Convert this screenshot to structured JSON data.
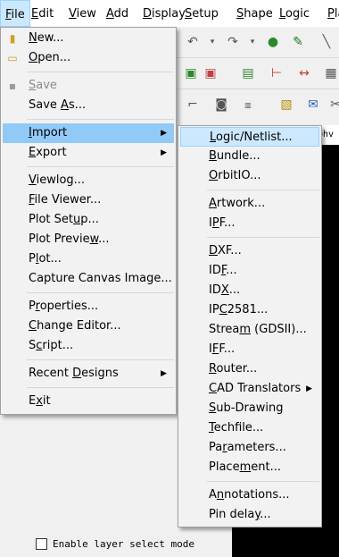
{
  "menubar": [
    {
      "pre": "",
      "ul": "F",
      "post": "ile",
      "active": true
    },
    {
      "pre": "",
      "ul": "E",
      "post": "dit"
    },
    {
      "pre": "",
      "ul": "V",
      "post": "iew"
    },
    {
      "pre": "",
      "ul": "A",
      "post": "dd"
    },
    {
      "pre": "",
      "ul": "D",
      "post": "isplay"
    },
    {
      "pre": "",
      "ul": "S",
      "post": "etup"
    },
    {
      "pre": "",
      "ul": "S",
      "post": "hape"
    },
    {
      "pre": "",
      "ul": "L",
      "post": "ogic"
    },
    {
      "pre": "",
      "ul": "P",
      "post": "la"
    }
  ],
  "file_menu": [
    {
      "type": "item",
      "pre": "",
      "ul": "N",
      "post": "ew...",
      "icon": "folder-new-icon",
      "glyph": "▮"
    },
    {
      "type": "item",
      "pre": "",
      "ul": "O",
      "post": "pen...",
      "icon": "folder-open-icon",
      "glyph": "▭"
    },
    {
      "type": "sep"
    },
    {
      "type": "item",
      "pre": "",
      "ul": "S",
      "post": "ave",
      "icon": "save-icon",
      "glyph": "▪",
      "disabled": true
    },
    {
      "type": "item",
      "pre": "Save ",
      "ul": "A",
      "post": "s..."
    },
    {
      "type": "sep"
    },
    {
      "type": "item",
      "pre": "",
      "ul": "I",
      "post": "mport",
      "submenu": true,
      "highlight": true
    },
    {
      "type": "item",
      "pre": "",
      "ul": "E",
      "post": "xport",
      "submenu": true
    },
    {
      "type": "sep"
    },
    {
      "type": "item",
      "pre": "",
      "ul": "V",
      "post": "iewlog..."
    },
    {
      "type": "item",
      "pre": "",
      "ul": "F",
      "post": "ile Viewer..."
    },
    {
      "type": "item",
      "pre": "Plot Set",
      "ul": "u",
      "post": "p..."
    },
    {
      "type": "item",
      "pre": "Plot Previe",
      "ul": "w",
      "post": "..."
    },
    {
      "type": "item",
      "pre": "P",
      "ul": "l",
      "post": "ot..."
    },
    {
      "type": "item",
      "pre": "Capture Canvas Image...",
      "ul": "",
      "post": ""
    },
    {
      "type": "sep"
    },
    {
      "type": "item",
      "pre": "P",
      "ul": "r",
      "post": "operties..."
    },
    {
      "type": "item",
      "pre": "",
      "ul": "C",
      "post": "hange Editor..."
    },
    {
      "type": "item",
      "pre": "S",
      "ul": "c",
      "post": "ript..."
    },
    {
      "type": "sep"
    },
    {
      "type": "item",
      "pre": "Recent ",
      "ul": "D",
      "post": "esigns",
      "submenu": true
    },
    {
      "type": "sep"
    },
    {
      "type": "item",
      "pre": "E",
      "ul": "x",
      "post": "it"
    }
  ],
  "import_menu": [
    {
      "type": "item",
      "pre": "",
      "ul": "L",
      "post": "ogic/Netlist...",
      "highlight": true
    },
    {
      "type": "item",
      "pre": "",
      "ul": "B",
      "post": "undle..."
    },
    {
      "type": "item",
      "pre": "",
      "ul": "O",
      "post": "rbitIO..."
    },
    {
      "type": "sep"
    },
    {
      "type": "item",
      "pre": "",
      "ul": "A",
      "post": "rtwork..."
    },
    {
      "type": "item",
      "pre": "I",
      "ul": "P",
      "post": "F..."
    },
    {
      "type": "sep"
    },
    {
      "type": "item",
      "pre": "",
      "ul": "D",
      "post": "XF..."
    },
    {
      "type": "item",
      "pre": "ID",
      "ul": "F",
      "post": "..."
    },
    {
      "type": "item",
      "pre": "ID",
      "ul": "X",
      "post": "..."
    },
    {
      "type": "item",
      "pre": "IP",
      "ul": "C",
      "post": "2581..."
    },
    {
      "type": "item",
      "pre": "Strea",
      "ul": "m",
      "post": " (GDSII)..."
    },
    {
      "type": "item",
      "pre": "I",
      "ul": "F",
      "post": "F..."
    },
    {
      "type": "item",
      "pre": "",
      "ul": "R",
      "post": "outer..."
    },
    {
      "type": "item",
      "pre": "",
      "ul": "C",
      "post": "AD Translators",
      "submenu": true
    },
    {
      "type": "item",
      "pre": "",
      "ul": "S",
      "post": "ub-Drawing"
    },
    {
      "type": "item",
      "pre": "",
      "ul": "T",
      "post": "echfile..."
    },
    {
      "type": "item",
      "pre": "Pa",
      "ul": "r",
      "post": "ameters..."
    },
    {
      "type": "item",
      "pre": "Place",
      "ul": "m",
      "post": "ent..."
    },
    {
      "type": "sep"
    },
    {
      "type": "item",
      "pre": "A",
      "ul": "n",
      "post": "notations..."
    },
    {
      "type": "item",
      "pre": "Pin dela",
      "ul": "y",
      "post": "..."
    }
  ],
  "canvas_text": "sbhv",
  "bottom": {
    "checkbox_label": "Enable layer select mode"
  },
  "colors": {
    "highlight_main": "#91c9f7",
    "highlight_sub": "#cce8ff",
    "canvas": "#000000"
  }
}
